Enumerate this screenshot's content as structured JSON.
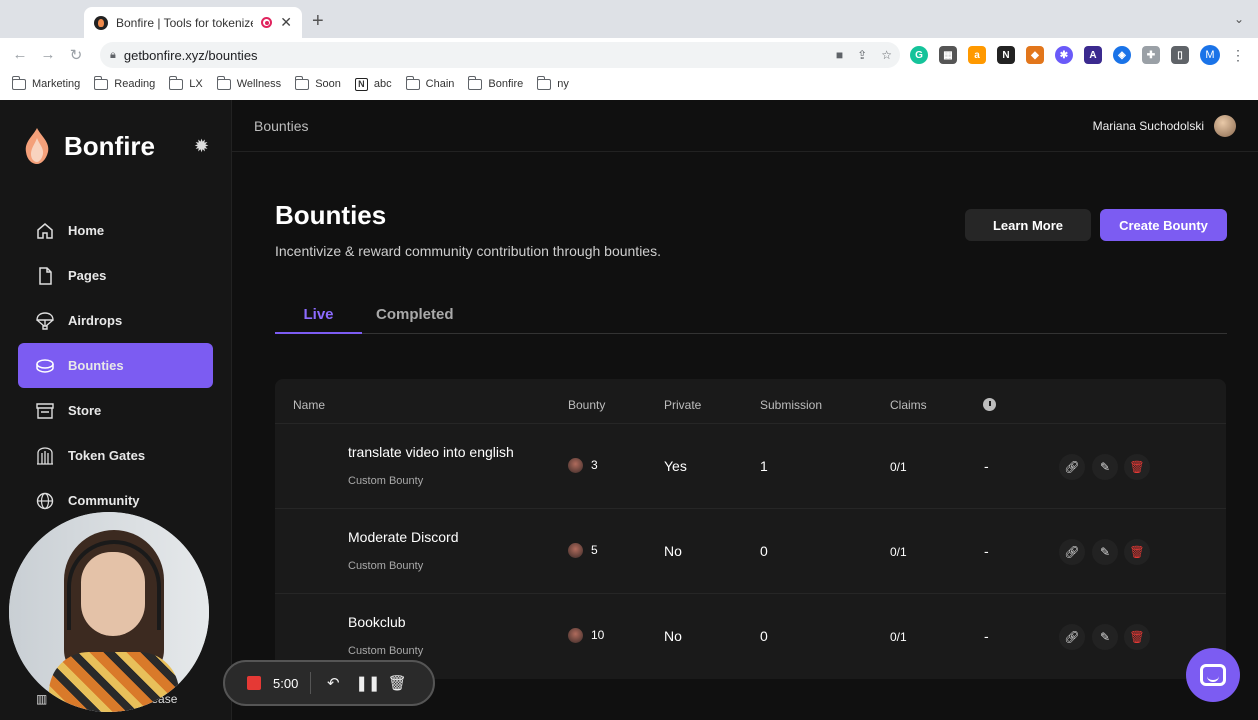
{
  "browser": {
    "tab_title": "Bonfire | Tools for tokenize",
    "url": "getbonfire.xyz/bounties",
    "profile_initial": "M",
    "bookmarks": [
      "Marketing",
      "Reading",
      "LX",
      "Wellness",
      "Soon",
      "abc",
      "Chain",
      "Bonfire",
      "ny"
    ]
  },
  "app": {
    "brand": "Bonfire",
    "breadcrumb": "Bounties",
    "user_name": "Mariana Suchodolski",
    "nav": [
      {
        "label": "Home",
        "icon": "home-icon"
      },
      {
        "label": "Pages",
        "icon": "page-icon"
      },
      {
        "label": "Airdrops",
        "icon": "parachute-icon"
      },
      {
        "label": "Bounties",
        "icon": "coins-icon",
        "active": true
      },
      {
        "label": "Store",
        "icon": "store-icon"
      },
      {
        "label": "Token Gates",
        "icon": "gate-icon"
      },
      {
        "label": "Community",
        "icon": "globe-icon"
      }
    ],
    "sidebar_bottom_label": "ease"
  },
  "page": {
    "title": "Bounties",
    "subtitle": "Incentivize & reward community contribution through bounties.",
    "learn_more": "Learn More",
    "create_bounty": "Create Bounty",
    "tabs": {
      "live": "Live",
      "completed": "Completed"
    },
    "columns": {
      "name": "Name",
      "bounty": "Bounty",
      "private": "Private",
      "submission": "Submission",
      "claims": "Claims"
    },
    "rows": [
      {
        "name": "translate video into english",
        "type": "Custom Bounty",
        "bounty": "3",
        "private": "Yes",
        "submission": "1",
        "claims": "0/1",
        "time": "-"
      },
      {
        "name": "Moderate Discord",
        "type": "Custom Bounty",
        "bounty": "5",
        "private": "No",
        "submission": "0",
        "claims": "0/1",
        "time": "-"
      },
      {
        "name": "Bookclub",
        "type": "Custom Bounty",
        "bounty": "10",
        "private": "No",
        "submission": "0",
        "claims": "0/1",
        "time": "-"
      }
    ]
  },
  "recorder": {
    "time": "5:00"
  },
  "colors": {
    "accent": "#7c5cf2",
    "background": "#101010",
    "sidebar": "#161616",
    "danger": "#e53935"
  }
}
